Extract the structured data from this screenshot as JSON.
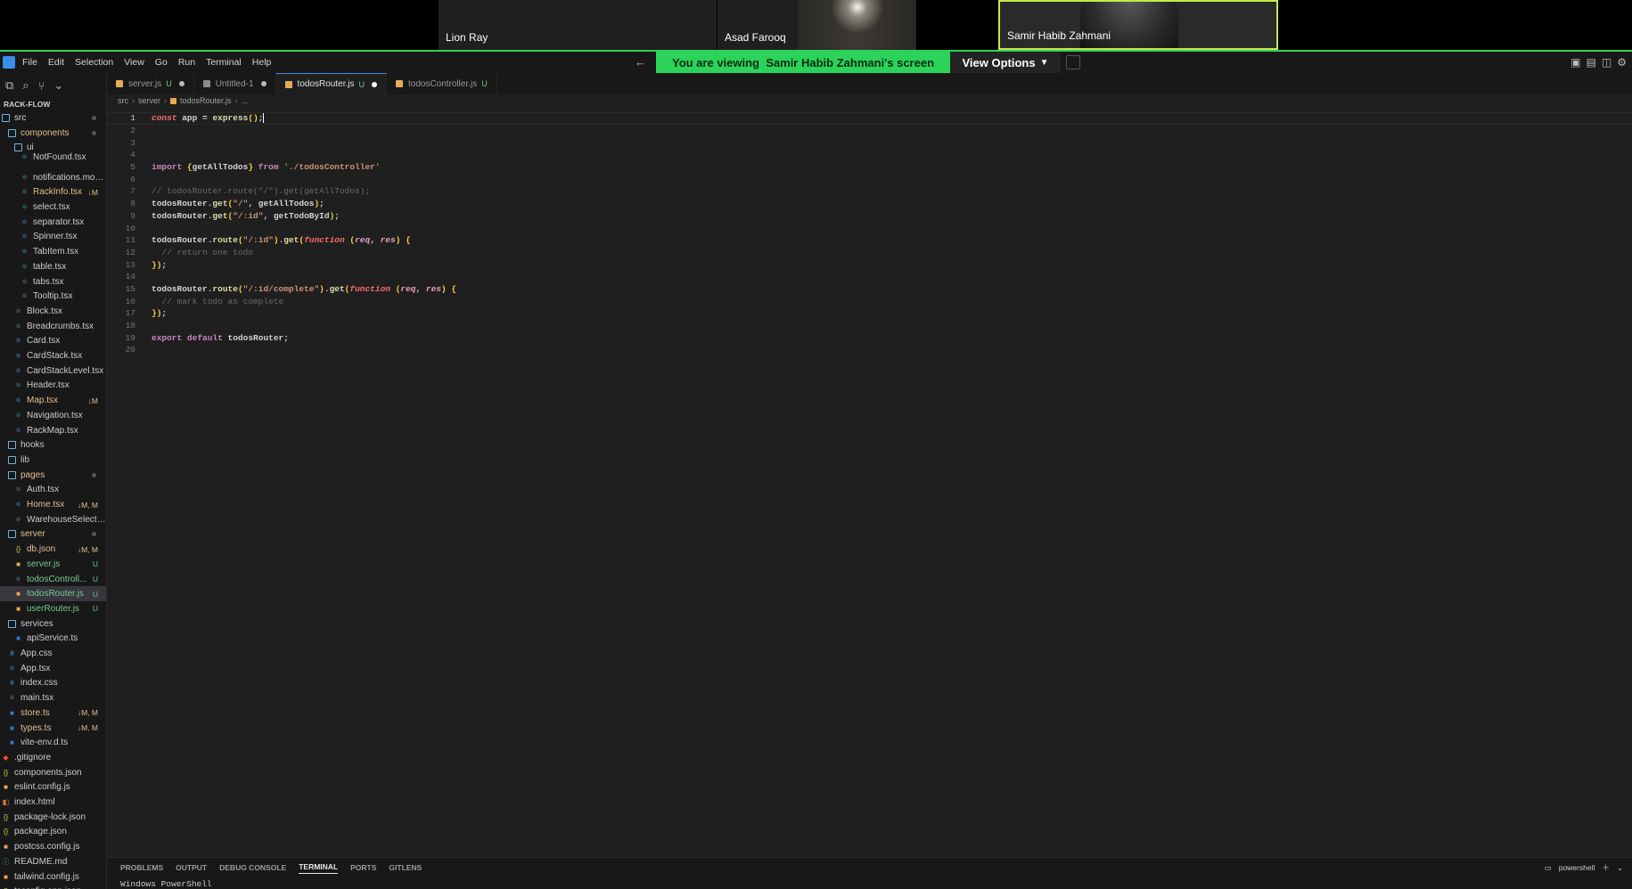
{
  "participants": [
    {
      "name": "Lion Ray"
    },
    {
      "name": "Asad Farooq"
    },
    {
      "name": "Samir Habib Zahmani"
    }
  ],
  "share_banner": {
    "prefix": "You are viewing",
    "owner": "Samir Habib Zahmani's screen",
    "view_options": "View Options"
  },
  "menu": [
    "File",
    "Edit",
    "Selection",
    "View",
    "Go",
    "Run",
    "Terminal",
    "Help"
  ],
  "explorer": {
    "title": "RACK-FLOW",
    "items": [
      {
        "label": "src",
        "type": "folder",
        "badge": "",
        "color": "#d4d4d4",
        "dot": true
      },
      {
        "label": "components",
        "type": "folder",
        "badge": "",
        "color": "#e2c08d",
        "dot": true
      },
      {
        "label": "ui",
        "type": "folder",
        "badge": "",
        "color": "#d4d4d4",
        "dot": false
      },
      {
        "label": "NotFound.tsx",
        "type": "file",
        "badge": "",
        "color": "#cccccc",
        "dot": false
      },
      {
        "label": "notifications.mod...",
        "type": "file",
        "badge": "",
        "color": "#cccccc",
        "dot": false
      },
      {
        "label": "RackInfo.tsx",
        "type": "file",
        "badge": "↓M",
        "color": "#e2c08d",
        "dot": false
      },
      {
        "label": "select.tsx",
        "type": "file",
        "badge": "",
        "color": "#cccccc",
        "dot": false
      },
      {
        "label": "separator.tsx",
        "type": "file",
        "badge": "",
        "color": "#cccccc",
        "dot": false
      },
      {
        "label": "Spinner.tsx",
        "type": "file",
        "badge": "",
        "color": "#cccccc",
        "dot": false
      },
      {
        "label": "TabItem.tsx",
        "type": "file",
        "badge": "",
        "color": "#cccccc",
        "dot": false
      },
      {
        "label": "table.tsx",
        "type": "file",
        "badge": "",
        "color": "#cccccc",
        "dot": false
      },
      {
        "label": "tabs.tsx",
        "type": "file",
        "badge": "",
        "color": "#cccccc",
        "dot": false
      },
      {
        "label": "Tooltip.tsx",
        "type": "file",
        "badge": "",
        "color": "#cccccc",
        "dot": false
      },
      {
        "label": "Block.tsx",
        "type": "file",
        "badge": "",
        "color": "#cccccc",
        "dot": false
      },
      {
        "label": "Breadcrumbs.tsx",
        "type": "file",
        "badge": "",
        "color": "#cccccc",
        "dot": false
      },
      {
        "label": "Card.tsx",
        "type": "file",
        "badge": "",
        "color": "#cccccc",
        "dot": false
      },
      {
        "label": "CardStack.tsx",
        "type": "file",
        "badge": "",
        "color": "#cccccc",
        "dot": false
      },
      {
        "label": "CardStackLevel.tsx",
        "type": "file",
        "badge": "",
        "color": "#cccccc",
        "dot": false
      },
      {
        "label": "Header.tsx",
        "type": "file",
        "badge": "",
        "color": "#cccccc",
        "dot": false
      },
      {
        "label": "Map.tsx",
        "type": "file",
        "badge": "↓M",
        "color": "#e2c08d",
        "dot": false
      },
      {
        "label": "Navigation.tsx",
        "type": "file",
        "badge": "",
        "color": "#cccccc",
        "dot": false
      },
      {
        "label": "RackMap.tsx",
        "type": "file",
        "badge": "",
        "color": "#cccccc",
        "dot": false
      },
      {
        "label": "hooks",
        "type": "folder",
        "badge": "",
        "color": "#cccccc",
        "dot": false
      },
      {
        "label": "lib",
        "type": "folder",
        "badge": "",
        "color": "#cccccc",
        "dot": false
      },
      {
        "label": "pages",
        "type": "folder",
        "badge": "",
        "color": "#e2c08d",
        "dot": true
      },
      {
        "label": "Auth.tsx",
        "type": "file",
        "badge": "",
        "color": "#cccccc",
        "dot": false
      },
      {
        "label": "Home.tsx",
        "type": "file",
        "badge": "↓M, M",
        "color": "#e2c08d",
        "dot": false
      },
      {
        "label": "WarehouseSelectio...",
        "type": "file",
        "badge": "",
        "color": "#cccccc",
        "dot": false
      },
      {
        "label": "server",
        "type": "folder",
        "badge": "",
        "color": "#e2c08d",
        "dot": true
      },
      {
        "label": "db.json",
        "type": "file",
        "badge": "↓M, M",
        "color": "#e2c08d",
        "dot": false
      },
      {
        "label": "server.js",
        "type": "file",
        "badge": "U",
        "color": "#73c991",
        "dot": false
      },
      {
        "label": "todosControll...",
        "type": "file",
        "badge": "U",
        "color": "#73c991",
        "dot": false
      },
      {
        "label": "todosRouter.js",
        "type": "file",
        "badge": "U",
        "color": "#73c991",
        "dot": false,
        "selected": true
      },
      {
        "label": "userRouter.js",
        "type": "file",
        "badge": "U",
        "color": "#73c991",
        "dot": false
      },
      {
        "label": "services",
        "type": "folder",
        "badge": "",
        "color": "#cccccc",
        "dot": false
      },
      {
        "label": "apiService.ts",
        "type": "file",
        "badge": "",
        "color": "#cccccc",
        "dot": false
      },
      {
        "label": "App.css",
        "type": "file",
        "badge": "",
        "color": "#cccccc",
        "dot": false
      },
      {
        "label": "App.tsx",
        "type": "file",
        "badge": "",
        "color": "#cccccc",
        "dot": false
      },
      {
        "label": "index.css",
        "type": "file",
        "badge": "",
        "color": "#cccccc",
        "dot": false
      },
      {
        "label": "main.tsx",
        "type": "file",
        "badge": "",
        "color": "#cccccc",
        "dot": false
      },
      {
        "label": "store.ts",
        "type": "file",
        "badge": "↓M, M",
        "color": "#e2c08d",
        "dot": false
      },
      {
        "label": "types.ts",
        "type": "file",
        "badge": "↓M, M",
        "color": "#e2c08d",
        "dot": false
      },
      {
        "label": "vite-env.d.ts",
        "type": "file",
        "badge": "",
        "color": "#cccccc",
        "dot": false
      },
      {
        "label": ".gitignore",
        "type": "file",
        "badge": "",
        "color": "#cccccc",
        "dot": false
      },
      {
        "label": "components.json",
        "type": "file",
        "badge": "",
        "color": "#cccccc",
        "dot": false
      },
      {
        "label": "eslint.config.js",
        "type": "file",
        "badge": "",
        "color": "#cccccc",
        "dot": false
      },
      {
        "label": "index.html",
        "type": "file",
        "badge": "",
        "color": "#cccccc",
        "dot": false
      },
      {
        "label": "package-lock.json",
        "type": "file",
        "badge": "",
        "color": "#cccccc",
        "dot": false
      },
      {
        "label": "package.json",
        "type": "file",
        "badge": "",
        "color": "#cccccc",
        "dot": false
      },
      {
        "label": "postcss.config.js",
        "type": "file",
        "badge": "",
        "color": "#cccccc",
        "dot": false
      },
      {
        "label": "README.md",
        "type": "file",
        "badge": "",
        "color": "#cccccc",
        "dot": false
      },
      {
        "label": "tailwind.config.js",
        "type": "file",
        "badge": "",
        "color": "#cccccc",
        "dot": false
      },
      {
        "label": "tsconfig.app.json",
        "type": "file",
        "badge": "",
        "color": "#cccccc",
        "dot": false
      }
    ]
  },
  "tabs": [
    {
      "label": "server.js",
      "mark": "U",
      "dirty": true,
      "active": false,
      "icon_color": "#e8ab53"
    },
    {
      "label": "Untitled-1",
      "mark": "",
      "dirty": true,
      "active": false,
      "icon_color": "#8a8a8a"
    },
    {
      "label": "todosRouter.js",
      "mark": "U",
      "dirty": true,
      "active": true,
      "icon_color": "#e8ab53"
    },
    {
      "label": "todosController.js",
      "mark": "U",
      "dirty": false,
      "active": false,
      "icon_color": "#e8ab53"
    }
  ],
  "breadcrumb": [
    "src",
    "server",
    "todosRouter.js",
    "..."
  ],
  "code": [
    {
      "n": "1",
      "text": "const app = express();"
    },
    {
      "n": "2",
      "text": ""
    },
    {
      "n": "3",
      "text": ""
    },
    {
      "n": "4",
      "text": ""
    },
    {
      "n": "5",
      "text": "import {getAllTodos} from './todosController'"
    },
    {
      "n": "6",
      "text": ""
    },
    {
      "n": "7",
      "text": "// todosRouter.route(\"/\").get(getAllTodos);"
    },
    {
      "n": "8",
      "text": "todosRouter.get(\"/\", getAllTodos);"
    },
    {
      "n": "9",
      "text": "todosRouter.get(\"/:id\", getTodoById);"
    },
    {
      "n": "10",
      "text": ""
    },
    {
      "n": "11",
      "text": "todosRouter.route(\"/:id\").get(function (req, res) {"
    },
    {
      "n": "12",
      "text": "  // return one todo"
    },
    {
      "n": "13",
      "text": "});"
    },
    {
      "n": "14",
      "text": ""
    },
    {
      "n": "15",
      "text": "todosRouter.route(\"/:id/complete\").get(function (req, res) {"
    },
    {
      "n": "16",
      "text": "  // mark todo as complete"
    },
    {
      "n": "17",
      "text": "});"
    },
    {
      "n": "18",
      "text": ""
    },
    {
      "n": "19",
      "text": "export default todosRouter;"
    },
    {
      "n": "20",
      "text": ""
    }
  ],
  "panel": {
    "tabs": [
      "PROBLEMS",
      "OUTPUT",
      "DEBUG CONSOLE",
      "TERMINAL",
      "PORTS",
      "GITLENS"
    ],
    "active_tab": "TERMINAL",
    "shell": "powershell",
    "terminal_text": "Windows PowerShell"
  },
  "colors": {
    "share_green": "#2bd35a",
    "speaker_border": "#c5e84a",
    "accent": "#3b8eea",
    "keyword_purple": "#c586c0",
    "keyword_red": "#f47067",
    "string": "#ce9178",
    "comment": "#6a6a6a",
    "function_yellow": "#dcdcaa",
    "untracked_green": "#73c991",
    "modified_yellow": "#e2c08d"
  },
  "icons": {
    "layout": [
      "sidebar-toggle-icon",
      "panel-toggle-icon",
      "secondary-sidebar-icon",
      "settings-icon"
    ]
  }
}
